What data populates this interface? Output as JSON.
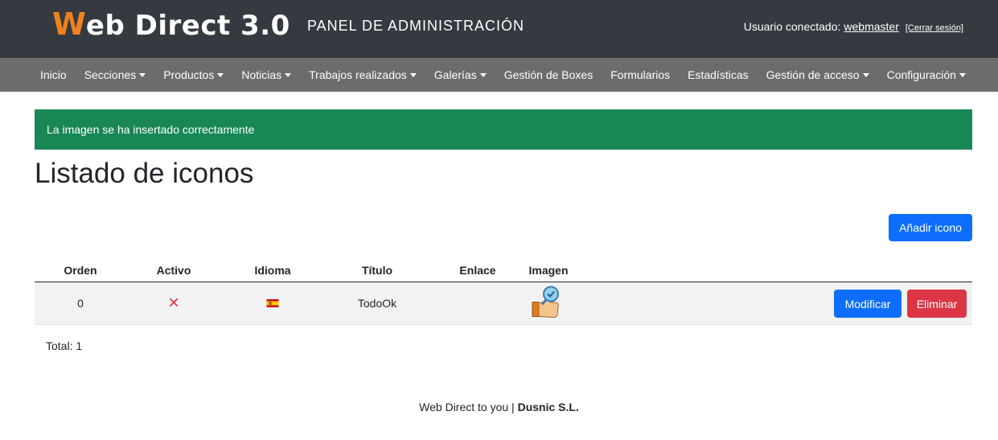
{
  "header": {
    "brand_first": "W",
    "brand_rest": "eb Direct 3.0",
    "subtitle": "PANEL DE ADMINISTRACIÓN",
    "user_label": "Usuario conectado:",
    "username": "webmaster",
    "logout": "[Cerrar sesión]"
  },
  "nav": {
    "items": [
      {
        "label": "Inicio",
        "dropdown": false
      },
      {
        "label": "Secciones",
        "dropdown": true
      },
      {
        "label": "Productos",
        "dropdown": true
      },
      {
        "label": "Noticias",
        "dropdown": true
      },
      {
        "label": "Trabajos realizados",
        "dropdown": true
      },
      {
        "label": "Galerías",
        "dropdown": true
      },
      {
        "label": "Gestión de Boxes",
        "dropdown": false
      },
      {
        "label": "Formularios",
        "dropdown": false
      },
      {
        "label": "Estadísticas",
        "dropdown": false
      },
      {
        "label": "Gestión de acceso",
        "dropdown": true
      },
      {
        "label": "Configuración",
        "dropdown": true
      }
    ]
  },
  "alert": {
    "message": "La imagen se ha insertado correctamente",
    "color": "#198754"
  },
  "page": {
    "title": "Listado de iconos",
    "add_button": "Añadir icono"
  },
  "table": {
    "columns": [
      "Orden",
      "Activo",
      "Idioma",
      "Título",
      "Enlace",
      "Imagen"
    ],
    "rows": [
      {
        "orden": "0",
        "activo_icon": "x-icon",
        "idioma_icon": "spain-flag-icon",
        "titulo": "TodoOk",
        "enlace": "",
        "imagen_icon": "thumbs-up-magnifier-icon",
        "modify": "Modificar",
        "delete": "Eliminar"
      }
    ],
    "total": "Total: 1"
  },
  "footer": {
    "text": "Web Direct to you |",
    "company": "Dusnic S.L."
  },
  "colors": {
    "header_bg": "#343a40",
    "nav_bg": "#6c6c6c",
    "brand_accent": "#f0821e",
    "primary": "#0d6efd",
    "danger": "#dc3545"
  }
}
